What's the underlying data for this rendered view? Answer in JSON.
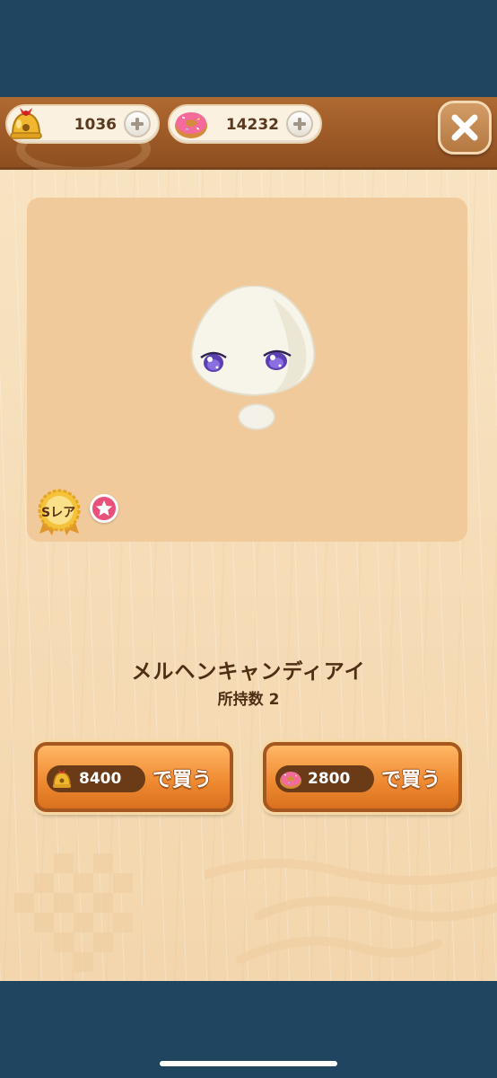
{
  "header": {
    "bells": {
      "value": "1036",
      "icon": "bell-icon"
    },
    "donuts": {
      "value": "14232",
      "icon": "donut-icon"
    },
    "close_icon": "close-icon"
  },
  "item": {
    "name": "メルヘンキャンディアイ",
    "owned_label": "所持数",
    "owned_count": "2",
    "rarity": "Sレア",
    "favorite_icon": "star-icon"
  },
  "purchase": {
    "bells": {
      "price": "8400",
      "label": "で買う",
      "icon": "bell-icon"
    },
    "donuts": {
      "price": "2800",
      "label": "で買う",
      "icon": "donut-icon"
    }
  },
  "colors": {
    "frame": "#1f4560",
    "header_wood": "#9d5a27",
    "panel_wood": "#f6ddb8",
    "preview_bg": "#f1ca9b",
    "button_orange": "#f08c33",
    "text_brown": "#4e2e14"
  }
}
